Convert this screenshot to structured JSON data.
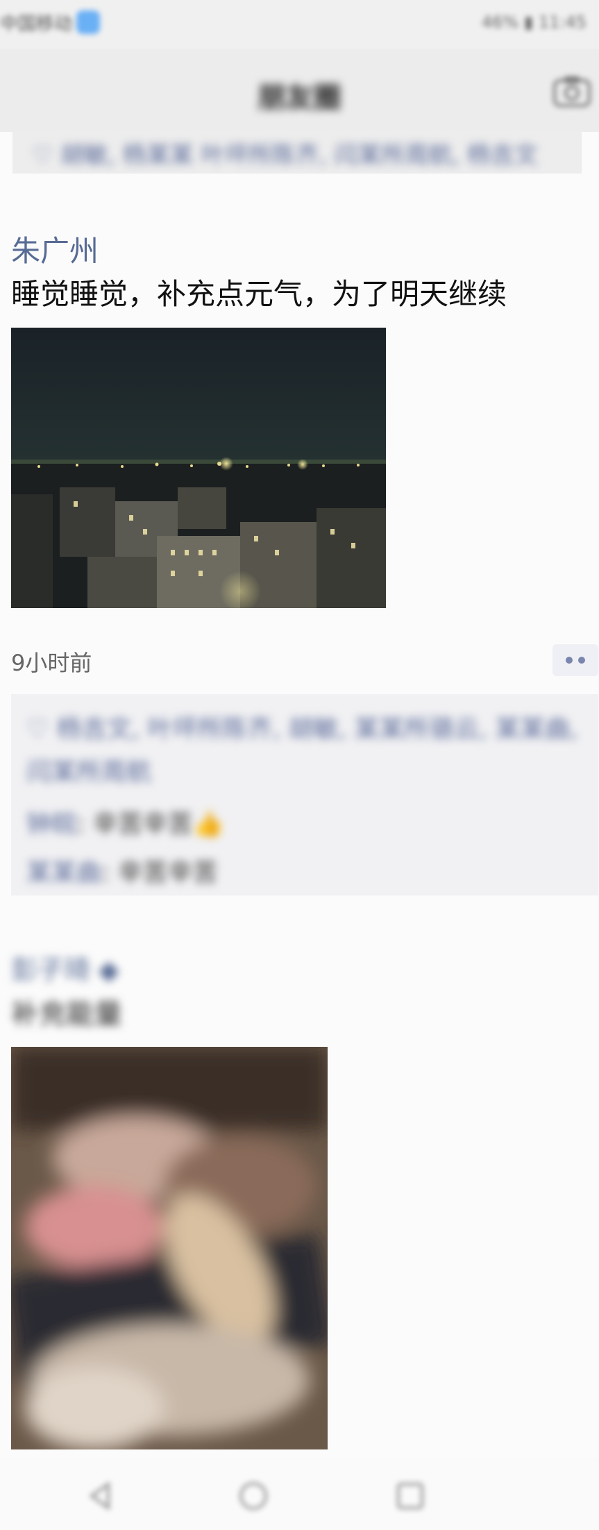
{
  "status_bar": {
    "carrier": "中国移动",
    "right_text": "46% ▮ 11:45"
  },
  "nav": {
    "title": "朋友圈",
    "camera_icon": "camera-icon"
  },
  "top_likes": {
    "text": "♡ 胡敏, 杨某某 叶坪所陈齐, 闫某所周航, 杨吉文"
  },
  "post1": {
    "author": "朱广州",
    "text": "睡觉睡觉，补充点元气，为了明天继续",
    "time": "9小时前",
    "likes": "♡ 杨吉文, 叶坪所陈齐, 胡敏, 某某所骆云, 某某曲, 闫某所周航",
    "comments": [
      {
        "name": "钟皖",
        "text": ": 辛苦辛苦👍"
      },
      {
        "name": "某某曲",
        "text": ": 辛苦辛苦"
      }
    ]
  },
  "post2": {
    "author": "彭子琦 ◆",
    "text": "补充能量"
  },
  "bottom_nav": [
    "back-icon",
    "home-icon",
    "recents-icon"
  ]
}
